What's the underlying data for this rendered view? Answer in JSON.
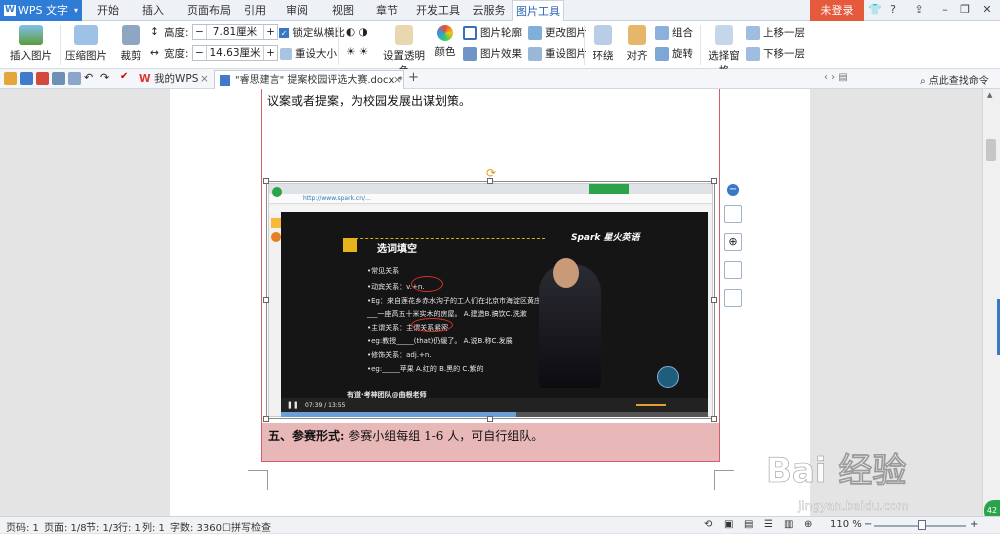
{
  "app": {
    "name": "WPS 文字",
    "logo_letter": "W"
  },
  "menu_tabs": [
    "开始",
    "插入",
    "页面布局",
    "引用",
    "审阅",
    "视图",
    "章节",
    "开发工具",
    "云服务",
    "图片工具"
  ],
  "active_tab": "图片工具",
  "login_label": "未登录",
  "ribbon": {
    "insert_picture": "插入图片",
    "compress_picture": "压缩图片",
    "crop": "裁剪",
    "height_label": "高度:",
    "height_value": "7.81厘米",
    "width_label": "宽度:",
    "width_value": "14.63厘米",
    "lock_ratio": "锁定纵横比",
    "reset_size": "重设大小",
    "set_transparent": "设置透明色",
    "color": "颜色",
    "picture_outline": "图片轮廓",
    "picture_effect": "图片效果",
    "change_picture": "更改图片",
    "reset_picture": "重设图片",
    "wrap": "环绕",
    "align": "对齐",
    "group": "组合",
    "rotate": "旋转",
    "selection_pane": "选择窗格",
    "bring_forward": "上移一层",
    "send_backward": "下移一层"
  },
  "doc_tabs": [
    {
      "label": "我的WPS"
    },
    {
      "label": "\"睿思建言\" 提案校园评选大赛.docx *"
    }
  ],
  "search_cmd": "点此查找命令",
  "document": {
    "line1": "议案或者提案，为校园发展出谋划策。",
    "line2_bold": "五、参赛形式:",
    "line2_rest": " 参赛小组每组 1-6 人，可自行组队。"
  },
  "image": {
    "slide_title": "选词填空",
    "brand": "Spark 星火英语",
    "url": "http://www.spark.cn/...",
    "lines": [
      "•常见关系",
      "•动宾关系：v.+n.",
      "•Eg：来自莲花乡赤水沟子的工人们在北京市海淀区黄庄___________。",
      "___一座高五十米实木的房屋。   A.建造B.搞饮C.洗漱",
      "•主谓关系：主谓关系紧密",
      "•eg:教授_____(that)仍缓了。   A.说B.称C.发展",
      "•修饰关系：adj.+n.",
      "•eg:_____苹果                A.红的 B.黑的 C.紫的"
    ],
    "video_caption": "有道·考神团队@曲根老师",
    "time": "07:39 / 13:55"
  },
  "status": {
    "page_code": "页码: 1",
    "pages": "页面: 1/8",
    "section": "节: 1/3",
    "row": "行: 1",
    "col": "列: 1",
    "word_count": "字数: 3360",
    "spell_check": "拼写检查",
    "zoom": "110 %"
  },
  "watermark": {
    "brand": "Bai 经验",
    "url": "jingyan.baidu.com"
  },
  "colors": {
    "accent": "#2f7cd6",
    "login": "#e55a3d",
    "shade": "#e8b8b8",
    "frame": "#d55e6a"
  }
}
